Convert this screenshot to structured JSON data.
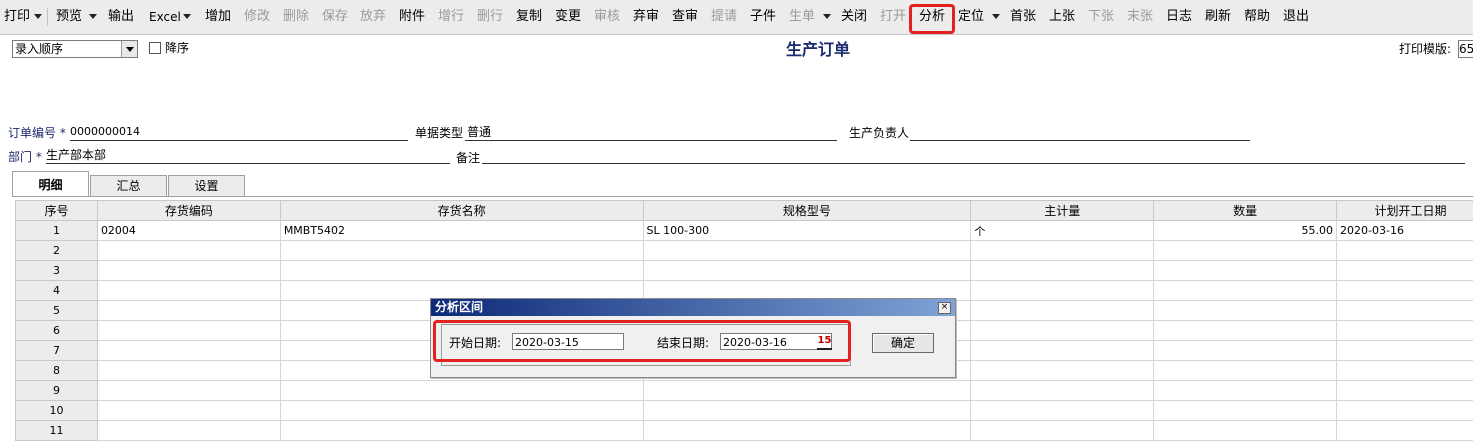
{
  "toolbar": {
    "print": "打印",
    "preview": "预览",
    "output": "输出",
    "excel": "Excel",
    "add": "增加",
    "modify": "修改",
    "delete": "删除",
    "save": "保存",
    "abandon": "放弃",
    "attach": "附件",
    "add_row": "增行",
    "del_row": "删行",
    "copy": "复制",
    "change": "变更",
    "audit": "审核",
    "unaudit": "弃审",
    "check_audit": "查审",
    "submit": "提请",
    "sub_item": "子件",
    "generate": "生单",
    "close": "关闭",
    "open": "打开",
    "analyze": "分析",
    "locate": "定位",
    "first": "首张",
    "prev": "上张",
    "next": "下张",
    "last": "末张",
    "log": "日志",
    "refresh": "刷新",
    "help": "帮助",
    "exit": "退出"
  },
  "header": {
    "sort_option": "录入顺序",
    "descending_label": "降序",
    "title": "生产订单",
    "print_template_label": "打印模版:",
    "print_template_value": "65"
  },
  "form": {
    "order_no_label": "订单编号",
    "order_no_value": "0000000014",
    "doc_type_label": "单据类型",
    "doc_type_value": "普通",
    "manager_label": "生产负责人",
    "dept_label": "部门",
    "dept_value": "生产部本部",
    "remark_label": "备注",
    "required_mark": "*"
  },
  "tabs": [
    "明细",
    "汇总",
    "设置"
  ],
  "grid": {
    "columns": [
      "序号",
      "存货编码",
      "存货名称",
      "规格型号",
      "主计量",
      "数量",
      "计划开工日期"
    ],
    "rows": [
      [
        "1",
        "02004",
        "MMBT5402",
        "SL 100-300",
        "个",
        "55.00",
        "2020-03-16"
      ],
      [
        "2",
        "",
        "",
        "",
        "",
        "",
        ""
      ],
      [
        "3",
        "",
        "",
        "",
        "",
        "",
        ""
      ],
      [
        "4",
        "",
        "",
        "",
        "",
        "",
        ""
      ],
      [
        "5",
        "",
        "",
        "",
        "",
        "",
        ""
      ],
      [
        "6",
        "",
        "",
        "",
        "",
        "",
        ""
      ],
      [
        "7",
        "",
        "",
        "",
        "",
        "",
        ""
      ],
      [
        "8",
        "",
        "",
        "",
        "",
        "",
        ""
      ],
      [
        "9",
        "",
        "",
        "",
        "",
        "",
        ""
      ],
      [
        "10",
        "",
        "",
        "",
        "",
        "",
        ""
      ],
      [
        "11",
        "",
        "",
        "",
        "",
        "",
        ""
      ]
    ]
  },
  "dialog": {
    "title": "分析区间",
    "close_glyph": "×",
    "start_label": "开始日期:",
    "start_value": "2020-03-15",
    "end_label": "结束日期:",
    "end_value": "2020-03-16",
    "calendar_glyph": "15",
    "ok_label": "确定"
  },
  "colors": {
    "highlight": "#e52020",
    "title_text": "#1b2a6e",
    "dialog_title_start": "#0d2a78",
    "dialog_title_end": "#7fa3d6"
  }
}
